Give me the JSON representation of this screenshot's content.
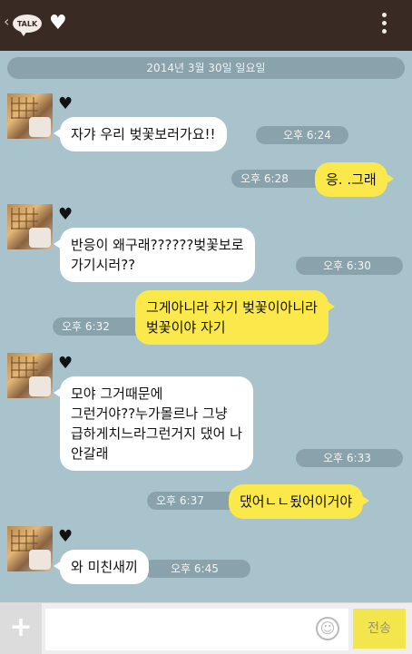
{
  "header": {
    "talk_label": "TALK",
    "back_icon": "chevron-left-icon",
    "heart_icon": "heart-icon",
    "menu_icon": "more-vertical-icon"
  },
  "date_divider": "2014년 3월 30일 일요일",
  "messages": [
    {
      "from": "other",
      "text": "자갸 우리 벚꽃보러가요!!",
      "time": "오후 6:24"
    },
    {
      "from": "me",
      "text": "응. .그래",
      "time": "오후 6:28"
    },
    {
      "from": "other",
      "lines": [
        "반응이 왜구래??????벚꽃보로",
        "가기시러??"
      ],
      "time": "오후 6:30"
    },
    {
      "from": "me",
      "lines": [
        "그게아니라 자기 벚꽃이아니라",
        "벚꽃이야 자기"
      ],
      "time": "오후 6:32"
    },
    {
      "from": "other",
      "lines": [
        "모야 그거때문에",
        "그런거야??누가몰르나 그냥",
        "급하게치느라그런거지 댔어 나",
        "안갈래"
      ],
      "time": "오후 6:33"
    },
    {
      "from": "me",
      "text": "댔어ㄴㄴ됬어이거야",
      "time": "오후 6:37"
    },
    {
      "from": "other",
      "text": "와 미친새끼",
      "time": "오후 6:45"
    }
  ],
  "colors": {
    "chat_bg": "#a9c3cd",
    "top_bar": "#3a2a24",
    "my_bubble": "#fbe84a",
    "their_bubble": "#ffffff",
    "time_pill": "#8aa2ac"
  },
  "input": {
    "placeholder": "",
    "plus_icon": "plus-icon",
    "emoji_icon": "emoticon-icon",
    "send_label": "전송"
  }
}
